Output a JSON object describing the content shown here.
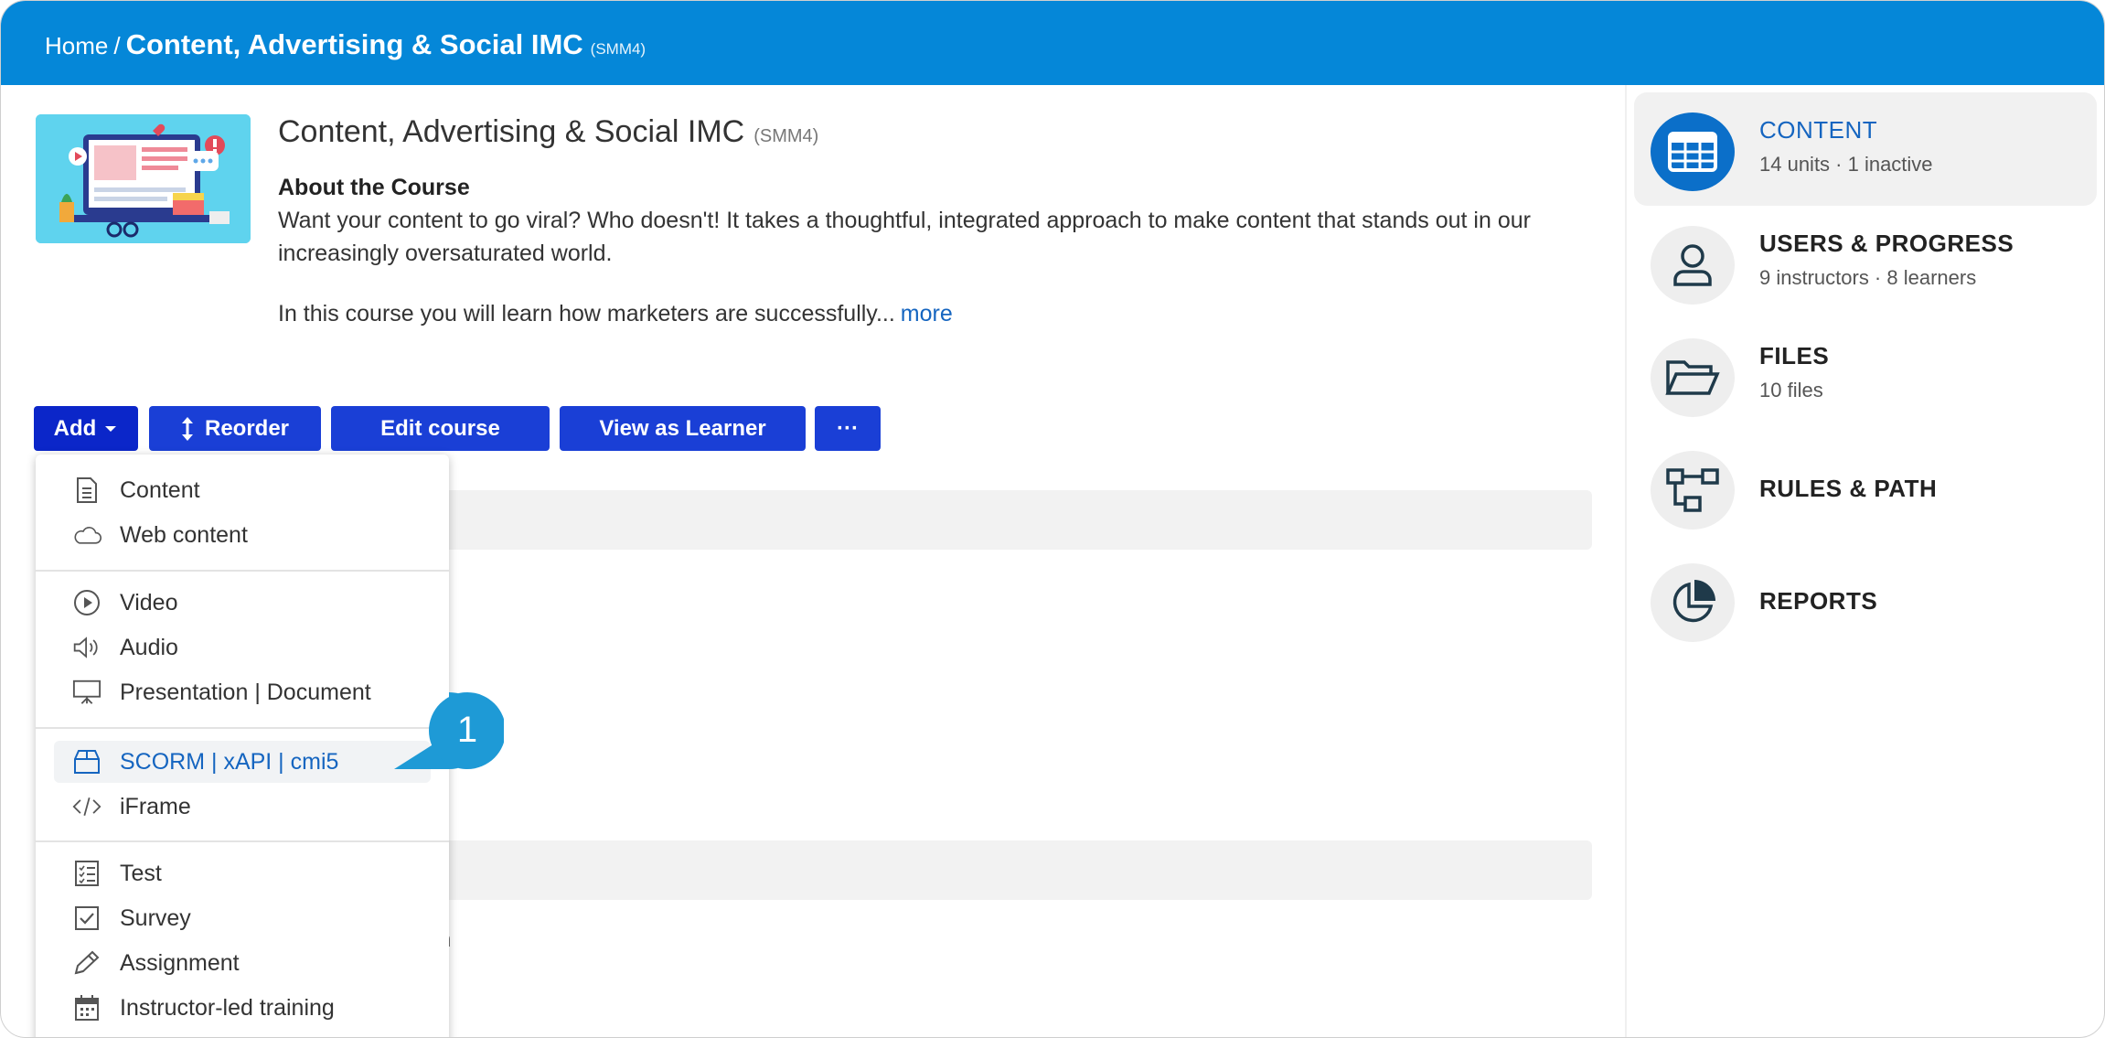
{
  "breadcrumb": {
    "home": "Home",
    "separator": "/",
    "current": "Content, Advertising & Social IMC",
    "code": "(SMM4)"
  },
  "course": {
    "title": "Content, Advertising & Social IMC",
    "code": "(SMM4)",
    "about_heading": "About the Course",
    "about_text": "Want your content to go viral? Who doesn't! It takes a thoughtful, integrated approach to make content that stands out in our increasingly oversaturated world.",
    "learn_text": "In this course you will learn how marketers are successfully...",
    "more_link": "more"
  },
  "toolbar": {
    "add": "Add",
    "reorder": "Reorder",
    "edit_course": "Edit course",
    "view_as_learner": "View as Learner",
    "more": "···"
  },
  "add_menu": {
    "items": [
      {
        "label": "Content",
        "icon": "document-icon"
      },
      {
        "label": "Web content",
        "icon": "cloud-icon"
      },
      {
        "label": "Video",
        "icon": "play-circle-icon"
      },
      {
        "label": "Audio",
        "icon": "speaker-icon"
      },
      {
        "label": "Presentation | Document",
        "icon": "presentation-icon"
      },
      {
        "label": "SCORM | xAPI | cmi5",
        "icon": "package-icon",
        "highlighted": true
      },
      {
        "label": "iFrame",
        "icon": "code-icon"
      },
      {
        "label": "Test",
        "icon": "checklist-icon"
      },
      {
        "label": "Survey",
        "icon": "checkbox-icon"
      },
      {
        "label": "Assignment",
        "icon": "pencil-icon"
      },
      {
        "label": "Instructor-led training",
        "icon": "calendar-icon"
      }
    ]
  },
  "background_list": {
    "partial_text": "m"
  },
  "callout": {
    "number": "1",
    "color": "#1e9ad6"
  },
  "sidebar": {
    "items": [
      {
        "title": "CONTENT",
        "sub": "14 units · 1 inactive",
        "icon": "grid-icon",
        "active": true
      },
      {
        "title": "USERS & PROGRESS",
        "sub": "9 instructors · 8 learners",
        "icon": "user-icon"
      },
      {
        "title": "FILES",
        "sub": "10 files",
        "icon": "folder-icon"
      },
      {
        "title": "RULES & PATH",
        "sub": "",
        "icon": "flow-icon"
      },
      {
        "title": "REPORTS",
        "sub": "",
        "icon": "pie-chart-icon"
      }
    ]
  },
  "colors": {
    "header": "#0587d8",
    "button": "#1a3fd6",
    "accent": "#1565c0",
    "active_circle": "#0b6fc9"
  }
}
